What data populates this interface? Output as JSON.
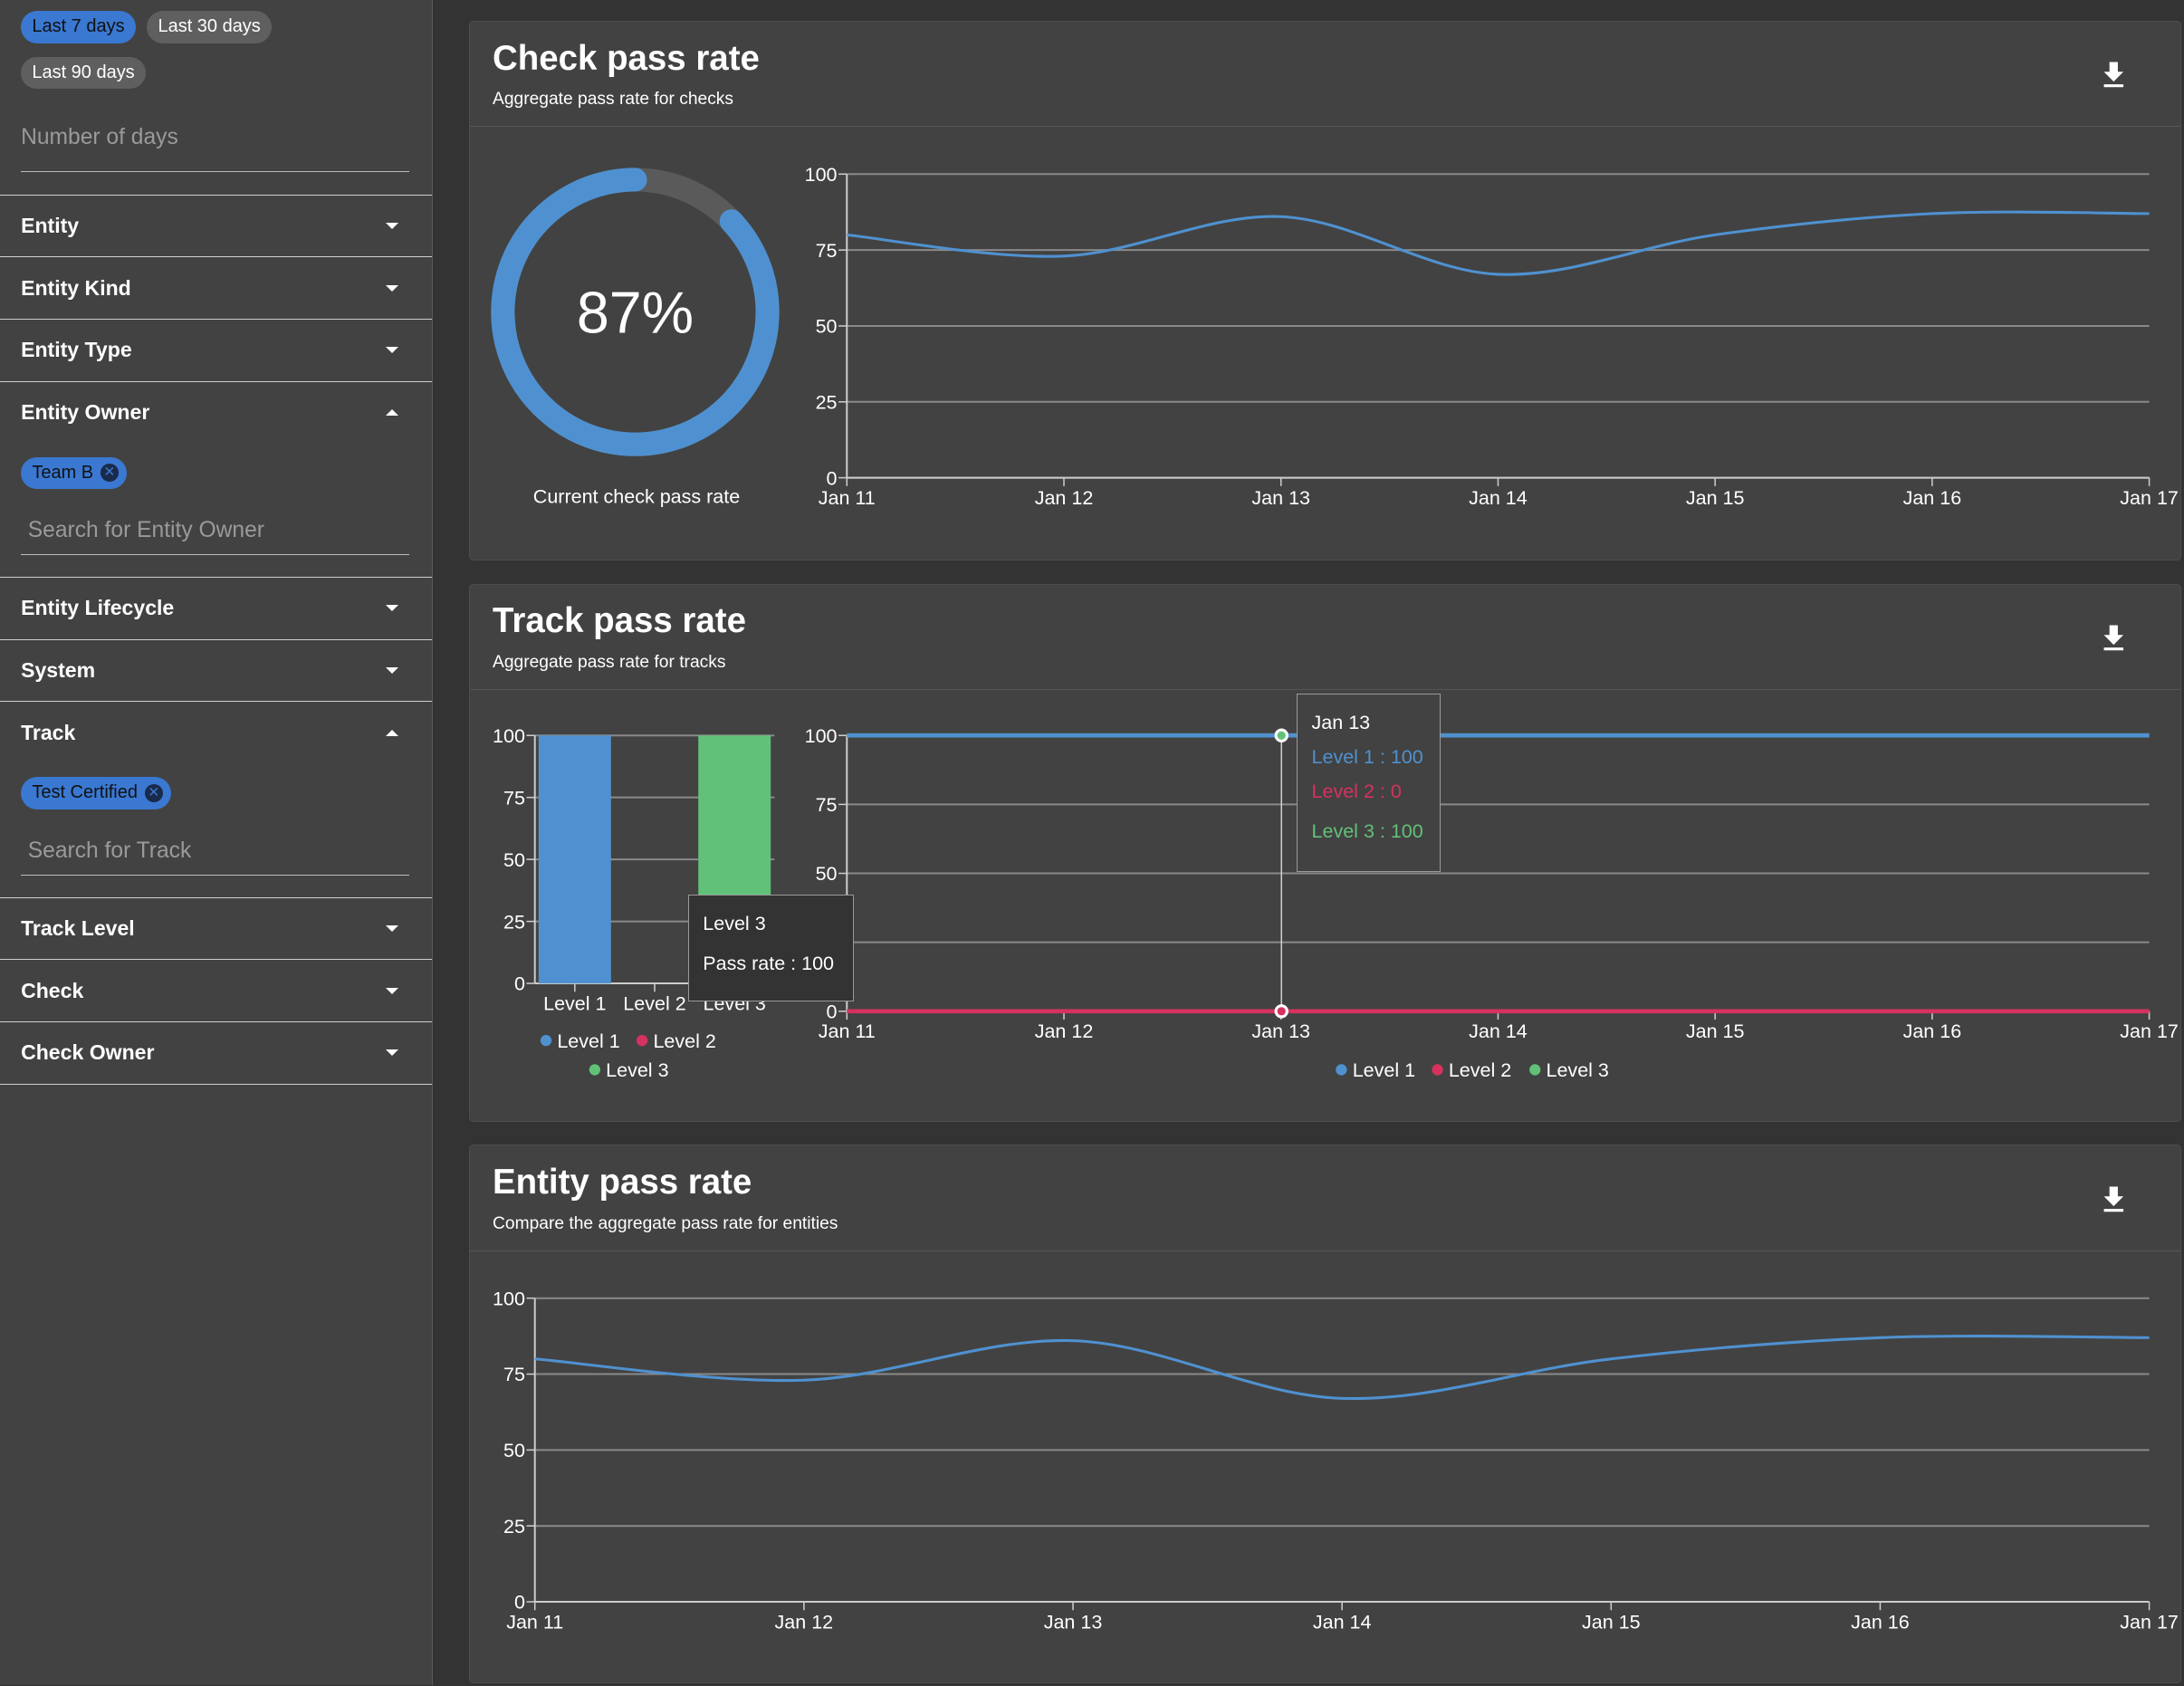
{
  "sidebar": {
    "date_chips": [
      {
        "label": "Last 7 days",
        "selected": true
      },
      {
        "label": "Last 30 days",
        "selected": false
      },
      {
        "label": "Last 90 days",
        "selected": false
      }
    ],
    "days_placeholder": "Number of days",
    "filters": [
      {
        "label": "Entity",
        "expanded": false
      },
      {
        "label": "Entity Kind",
        "expanded": false
      },
      {
        "label": "Entity Type",
        "expanded": false
      },
      {
        "label": "Entity Owner",
        "expanded": true,
        "chip": "Team B",
        "search_placeholder": "Search for Entity Owner"
      },
      {
        "label": "Entity Lifecycle",
        "expanded": false
      },
      {
        "label": "System",
        "expanded": false
      },
      {
        "label": "Track",
        "expanded": true,
        "chip": "Test Certified",
        "search_placeholder": "Search for Track"
      },
      {
        "label": "Track Level",
        "expanded": false
      },
      {
        "label": "Check",
        "expanded": false
      },
      {
        "label": "Check Owner",
        "expanded": false
      }
    ]
  },
  "cards": [
    {
      "title": "Check pass rate",
      "subtitle": "Aggregate pass rate for checks",
      "gauge_value": "87%",
      "gauge_fraction": 0.87,
      "gauge_label": "Current check pass rate"
    },
    {
      "title": "Track pass rate",
      "subtitle": "Aggregate pass rate for tracks",
      "bar_tooltip": {
        "title": "Level 3",
        "line": "Pass rate : 100"
      },
      "line_tooltip": {
        "title": "Jan 13",
        "lines": [
          "Level 1 : 100",
          "Level 2 : 0",
          "Level 3 : 100"
        ]
      }
    },
    {
      "title": "Entity pass rate",
      "subtitle": "Compare the aggregate pass rate for entities"
    }
  ],
  "colors": {
    "level1": "#4f91d0",
    "level2": "#d6325f",
    "level3": "#62c178",
    "gauge_track": "#5a5a5a"
  },
  "chart_data": [
    {
      "type": "line",
      "x": [
        "Jan 11",
        "Jan 12",
        "Jan 13",
        "Jan 14",
        "Jan 15",
        "Jan 16",
        "Jan 17"
      ],
      "values": [
        80,
        73,
        86,
        67,
        80,
        87,
        87
      ],
      "ylim": [
        0,
        100
      ],
      "yticks": [
        "0",
        "25",
        "50",
        "75",
        "100"
      ],
      "grid": true
    },
    {
      "type": "bar",
      "categories": [
        "Level 1",
        "Level 2",
        "Level 3"
      ],
      "values": [
        100,
        0,
        100
      ],
      "ylim": [
        0,
        100
      ],
      "yticks": [
        "0",
        "25",
        "50",
        "75",
        "100"
      ],
      "legend": [
        "Level 1",
        "Level 2",
        "Level 3"
      ],
      "grid": true
    },
    {
      "type": "line",
      "x": [
        "Jan 11",
        "Jan 12",
        "Jan 13",
        "Jan 14",
        "Jan 15",
        "Jan 16",
        "Jan 17"
      ],
      "series": [
        {
          "name": "Level 1",
          "values": [
            100,
            100,
            100,
            100,
            100,
            100,
            100
          ]
        },
        {
          "name": "Level 2",
          "values": [
            0,
            0,
            0,
            0,
            0,
            0,
            0
          ]
        },
        {
          "name": "Level 3",
          "values": [
            100,
            100,
            100,
            100,
            100,
            100,
            100
          ]
        }
      ],
      "ylim": [
        0,
        100
      ],
      "yticks": [
        "0",
        "25",
        "50",
        "75",
        "100"
      ],
      "legend": [
        "Level 1",
        "Level 2",
        "Level 3"
      ],
      "grid": true
    },
    {
      "type": "line",
      "x": [
        "Jan 11",
        "Jan 12",
        "Jan 13",
        "Jan 14",
        "Jan 15",
        "Jan 16",
        "Jan 17"
      ],
      "values": [
        80,
        73,
        86,
        67,
        80,
        87,
        87
      ],
      "ylim": [
        0,
        100
      ],
      "yticks": [
        "0",
        "25",
        "50",
        "75",
        "100"
      ],
      "grid": true
    }
  ]
}
